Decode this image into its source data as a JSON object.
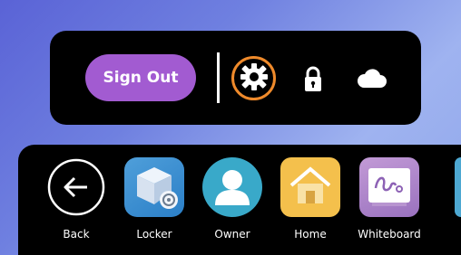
{
  "top_bar": {
    "sign_out_label": "Sign Out",
    "icons": [
      "gear-icon",
      "lock-icon",
      "cloud-icon"
    ],
    "accent_color": "#a25bd1",
    "focus_ring_color": "#ef8a2b"
  },
  "dock": {
    "items": [
      {
        "label": "Back",
        "icon": "back-arrow-icon"
      },
      {
        "label": "Locker",
        "icon": "locker-icon"
      },
      {
        "label": "Owner",
        "icon": "owner-icon"
      },
      {
        "label": "Home",
        "icon": "home-icon"
      },
      {
        "label": "Whiteboard",
        "icon": "whiteboard-icon"
      }
    ]
  }
}
